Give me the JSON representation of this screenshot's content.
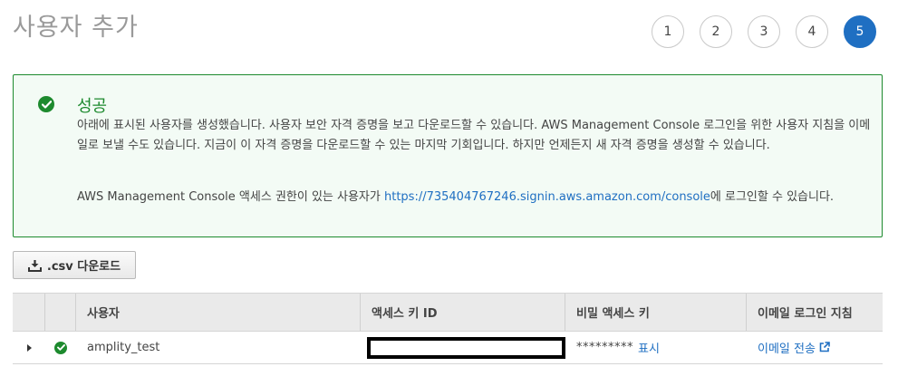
{
  "header": {
    "title": "사용자 추가",
    "steps": [
      "1",
      "2",
      "3",
      "4",
      "5"
    ],
    "active_step": "5"
  },
  "alert": {
    "icon": "check-circle-icon",
    "title": "성공",
    "body": "아래에 표시된 사용자를 생성했습니다. 사용자 보안 자격 증명을 보고 다운로드할 수 있습니다. AWS Management Console 로그인을 위한 사용자 지침을 이메일로 보낼 수도 있습니다. 지금이 이 자격 증명을 다운로드할 수 있는 마지막 기회입니다. 하지만 언제든지 새 자격 증명을 생성할 수 있습니다.",
    "console_prefix": "AWS Management Console 액세스 권한이 있는 사용자가 ",
    "console_link": "https://735404767246.signin.aws.amazon.com/console",
    "console_suffix": "에 로그인할 수 있습니다."
  },
  "download_button": {
    "icon": "download-icon",
    "label": ".csv 다운로드"
  },
  "table": {
    "columns": [
      "",
      "",
      "사용자",
      "액세스 키 ID",
      "비밀 액세스 키",
      "이메일 로그인 지침"
    ],
    "rows": [
      {
        "status_icon": "check-circle-icon",
        "user": "amplity_test",
        "access_key_id": "",
        "secret_masked": "*********",
        "secret_show_label": "표시",
        "email_label": "이메일 전송",
        "email_icon": "external-link-icon"
      }
    ]
  },
  "colors": {
    "success": "#1d8a2e",
    "link": "#1f6fc2",
    "active_step": "#1f6fc2",
    "alert_bg": "#f3fbf5"
  }
}
